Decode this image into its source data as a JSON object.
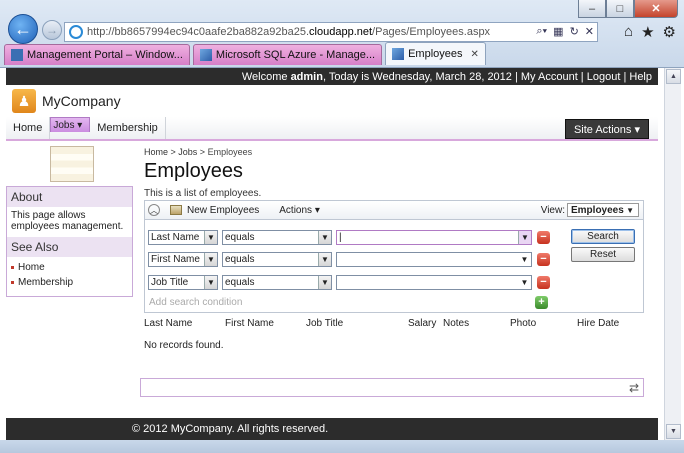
{
  "browser": {
    "window_buttons": {
      "minimize": "–",
      "maximize": "□",
      "close": "✕"
    },
    "address": {
      "prefix": "http://bb8657994ec94c0aafe2ba882a92ba25.",
      "host": "cloudapp.net",
      "path": "/Pages/Employees.aspx"
    },
    "tabs": [
      {
        "label": "Management Portal – Window...",
        "active": false
      },
      {
        "label": "Microsoft SQL Azure - Manage...",
        "active": false
      },
      {
        "label": "Employees",
        "active": true
      }
    ],
    "nav_icons": [
      "home-icon",
      "favorites-star-icon",
      "tools-gear-icon"
    ]
  },
  "topbar": {
    "welcome_prefix": "Welcome ",
    "user": "admin",
    "welcome_suffix": ", Today is Wednesday, March 28, 2012 | ",
    "my_account": "My Account",
    "sep": " | ",
    "logout": "Logout",
    "sep2": " | ",
    "help": "Help"
  },
  "header": {
    "brand": "MyCompany"
  },
  "menu": {
    "items": [
      {
        "label": "Home"
      },
      {
        "label": "Jobs ▾"
      },
      {
        "label": "Membership"
      }
    ],
    "site_actions": "Site Actions ▾"
  },
  "sidebar": {
    "about_title": "About",
    "about_text": "This page allows employees management.",
    "see_also_title": "See Also",
    "links": [
      {
        "label": "Home"
      },
      {
        "label": "Membership"
      }
    ]
  },
  "main": {
    "breadcrumb": {
      "home": "Home",
      "sep1": " > ",
      "jobs": "Jobs",
      "sep2": " > ",
      "current": "Employees"
    },
    "title": "Employees",
    "description": "This is a list of employees."
  },
  "toolbar": {
    "new_label": "New Employees",
    "actions_label": "Actions ▾",
    "view_label": "View:",
    "view_value": "Employees"
  },
  "search": {
    "rows": [
      {
        "field": "Last Name",
        "operator": "equals",
        "value": ""
      },
      {
        "field": "First Name",
        "operator": "equals",
        "value": ""
      },
      {
        "field": "Job Title",
        "operator": "equals",
        "value": ""
      }
    ],
    "add_condition": "Add search condition",
    "search_button": "Search",
    "reset_button": "Reset"
  },
  "grid": {
    "columns": [
      "Last Name",
      "First Name",
      "Job Title",
      "Salary",
      "Notes",
      "Photo",
      "Hire Date"
    ],
    "empty_message": "No records found."
  },
  "footer": {
    "text": "© 2012 MyCompany. All rights reserved."
  }
}
